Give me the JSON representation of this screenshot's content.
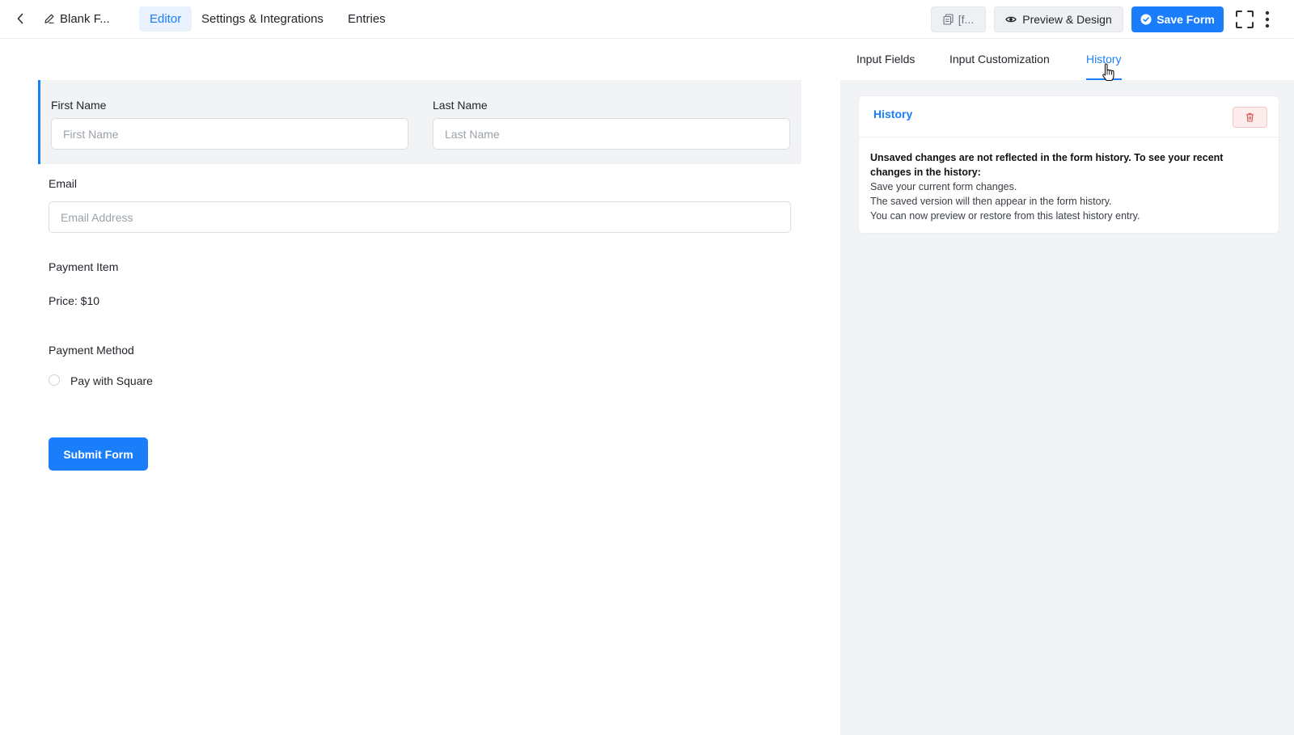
{
  "header": {
    "form_title": "Blank F...",
    "tabs": [
      {
        "label": "Editor",
        "active": true
      },
      {
        "label": "Settings & Integrations",
        "active": false
      },
      {
        "label": "Entries",
        "active": false
      }
    ],
    "shortcode_label": "[f...",
    "preview_label": "Preview & Design",
    "save_label": "Save Form",
    "icons": {
      "back": "chevron-left-icon",
      "title": "pencil-icon",
      "shortcode": "copy-icon",
      "preview": "eye-icon",
      "save": "check-circle-icon",
      "fullscreen": "expand-icon",
      "more": "more-vertical-icon"
    }
  },
  "form": {
    "first_name": {
      "label": "First Name",
      "placeholder": "First Name",
      "value": ""
    },
    "last_name": {
      "label": "Last Name",
      "placeholder": "Last Name",
      "value": ""
    },
    "email": {
      "label": "Email",
      "placeholder": "Email Address",
      "value": ""
    },
    "payment_item": {
      "label": "Payment Item",
      "price_text": "Price: $10"
    },
    "payment_method": {
      "label": "Payment Method",
      "option": "Pay with Square",
      "selected": false
    },
    "submit_label": "Submit Form"
  },
  "sidebar": {
    "tabs": [
      {
        "label": "Input Fields",
        "active": false
      },
      {
        "label": "Input Customization",
        "active": false
      },
      {
        "label": "History",
        "active": true
      }
    ],
    "history": {
      "title": "History",
      "notice": "Unsaved changes are not reflected in the form history. To see your recent changes in the history:",
      "steps": [
        "Save your current form changes.",
        "The saved version will then appear in the form history.",
        "You can now preview or restore from this latest history entry."
      ]
    }
  },
  "colors": {
    "accent": "#1a7efb",
    "danger_bg": "#fdecec",
    "danger": "#e05252",
    "panel_bg": "#f2f3f5"
  }
}
